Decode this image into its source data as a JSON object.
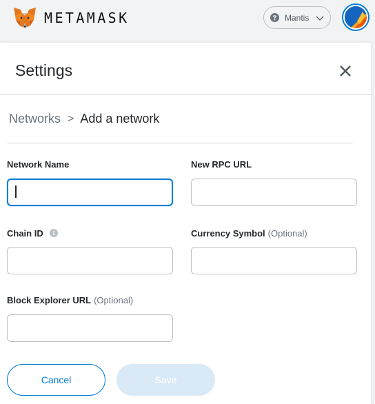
{
  "header": {
    "logo_text": "METAMASK",
    "logo_icon": "metamask-fox-icon",
    "network": {
      "label": "Mantis",
      "icon": "help-icon",
      "dropdown_icon": "chevron-down-icon"
    },
    "avatar_icon": "account-identicon"
  },
  "settings": {
    "title": "Settings",
    "close_icon": "close-icon"
  },
  "breadcrumb": {
    "parent": "Networks",
    "separator": ">",
    "current": "Add a network"
  },
  "form": {
    "network_name": {
      "label": "Network Name",
      "value": ""
    },
    "rpc_url": {
      "label": "New RPC URL",
      "value": ""
    },
    "chain_id": {
      "label": "Chain ID",
      "value": "",
      "info_icon": "info-icon"
    },
    "currency_symbol": {
      "label": "Currency Symbol",
      "optional": "(Optional)",
      "value": ""
    },
    "block_explorer": {
      "label": "Block Explorer URL",
      "optional": "(Optional)",
      "value": ""
    }
  },
  "buttons": {
    "cancel": "Cancel",
    "save": "Save"
  },
  "colors": {
    "accent": "#037dd6",
    "save_disabled_bg": "#d9e9f6",
    "border": "#bbc0c5",
    "muted_text": "#6a737d"
  }
}
